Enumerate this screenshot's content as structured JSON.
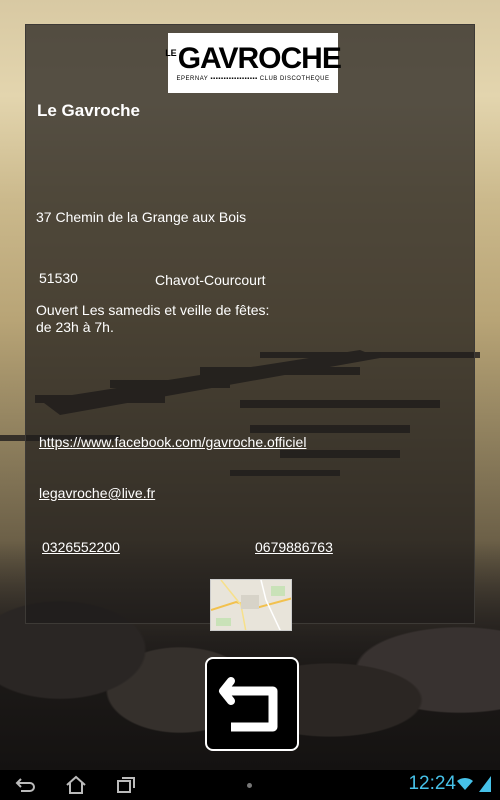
{
  "logo": {
    "prefix": "LE",
    "name": "GAVROCHE",
    "subtitle": "EPERNAY ▪▪▪▪▪▪▪▪▪▪▪▪▪▪▪▪▪▪ CLUB DISCOTHEQUE"
  },
  "venue": {
    "title": "Le Gavroche",
    "address": "37 Chemin de la Grange aux Bois",
    "postal_code": "51530",
    "city": "Chavot-Courcourt",
    "hours_line1": "Ouvert Les samedis et veille de fêtes:",
    "hours_line2": "de 23h à 7h.",
    "facebook": "https://www.facebook.com/gavroche.officiel",
    "email": "legavroche@live.fr",
    "phone1": "0326552200",
    "phone2": "0679886763"
  },
  "status_bar": {
    "time": "12:24",
    "accent": "#46c1e8"
  }
}
